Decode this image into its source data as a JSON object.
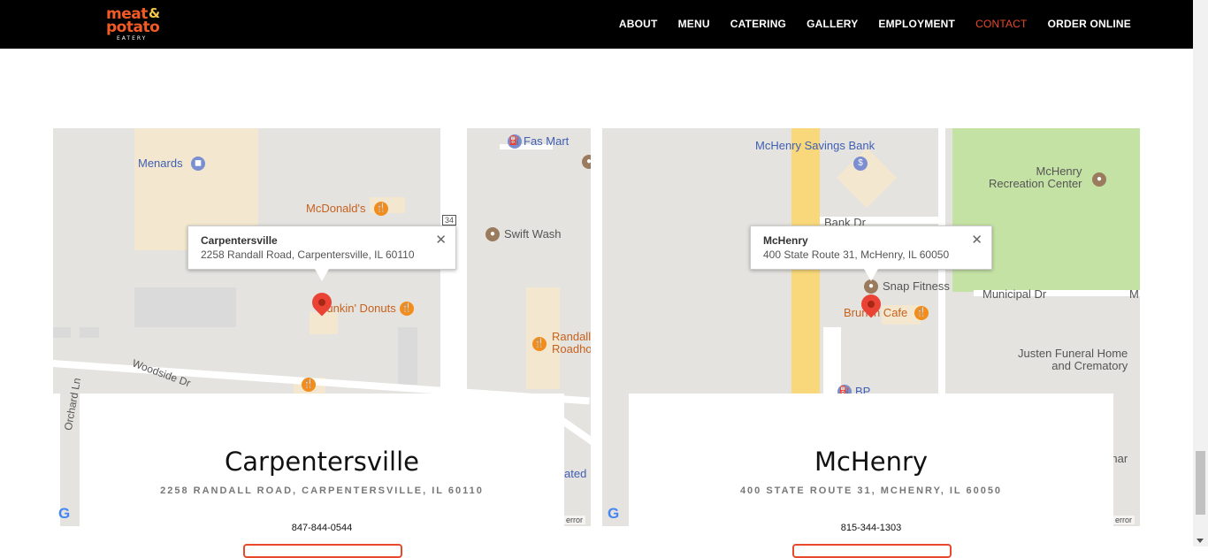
{
  "nav": {
    "logo": {
      "word1": "meat",
      "amp": "&",
      "word2": "potato",
      "sub": "EATERY"
    },
    "items": [
      {
        "label": "ABOUT"
      },
      {
        "label": "MENU"
      },
      {
        "label": "CATERING"
      },
      {
        "label": "GALLERY"
      },
      {
        "label": "EMPLOYMENT"
      },
      {
        "label": "CONTACT",
        "active": true
      },
      {
        "label": "ORDER ONLINE"
      }
    ]
  },
  "maps": {
    "left": {
      "pois": {
        "menards": "Menards",
        "mcdonalds": "McDonald's",
        "fasmart": "Fas Mart",
        "swiftwash": "Swift Wash",
        "dunkin": "Dunkin' Donuts",
        "randall": "Randall\nRoadho",
        "woodside": "Woodside Dr",
        "orchard": "Orchard Ln",
        "route": "34",
        "ated": "ated"
      },
      "info": {
        "title": "Carpentersville",
        "address": "2258 Randall Road, Carpentersville, IL 60110"
      },
      "error": "error"
    },
    "right": {
      "pois": {
        "bank": "McHenry Savings Bank",
        "recreation": "McHenry\nRecreation Center",
        "bankdr": "Bank Dr",
        "snap": "Snap Fitness",
        "brunch": "Brunch Cafe",
        "municipal": "Municipal Dr",
        "justen": "Justen Funeral Home\nand Crematory",
        "bp": "BP",
        "char": "Char",
        "m": "M"
      },
      "info": {
        "title": "McHenry",
        "address": "400 State Route 31, McHenry, IL 60050"
      },
      "error": "error"
    }
  },
  "locations": [
    {
      "city": "Carpentersville",
      "address": "2258 RANDALL ROAD, CARPENTERSVILLE, IL 60110",
      "phone": "847-844-0544"
    },
    {
      "city": "McHenry",
      "address": "400 STATE ROUTE 31, MCHENRY, IL 60050",
      "phone": "815-344-1303"
    }
  ],
  "colors": {
    "accent": "#e8492b",
    "navbar": "#000000"
  }
}
